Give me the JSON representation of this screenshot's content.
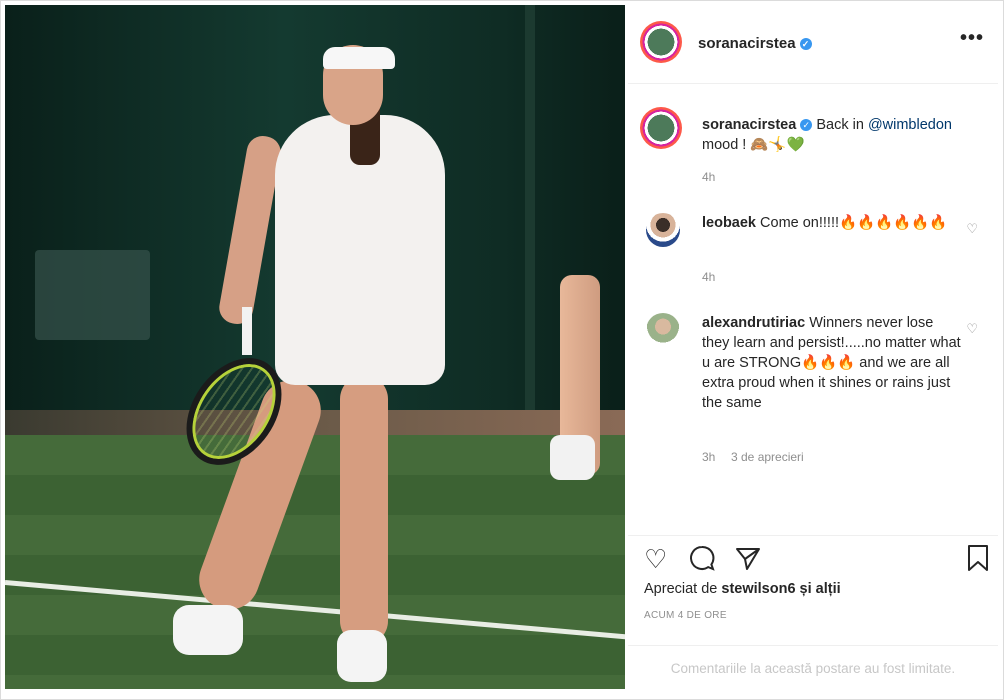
{
  "post": {
    "username": "soranacirstea",
    "more_label": "•••"
  },
  "caption": {
    "username": "soranacirstea",
    "text_before": "Back in ",
    "mention": "@wimbledon",
    "text_after": "mood ! 🙈🤸💚",
    "time": "4h"
  },
  "comments": [
    {
      "username": "leobaek",
      "text": "Come on!!!!!🔥🔥🔥🔥🔥🔥",
      "time": "4h",
      "likes": ""
    },
    {
      "username": "alexandrutiriac",
      "text": "Winners never lose they learn and persist!.....no matter what u are STRONG🔥🔥🔥 and we are all extra proud when it shines or rains just the same",
      "time": "3h",
      "likes": "3 de aprecieri"
    }
  ],
  "likes_line": {
    "prefix": "Apreciat de ",
    "user": "stewilson6",
    "suffix": " și alții"
  },
  "post_age": "ACUM 4 DE ORE",
  "comments_limited": "Comentariile la această postare au fost limitate."
}
